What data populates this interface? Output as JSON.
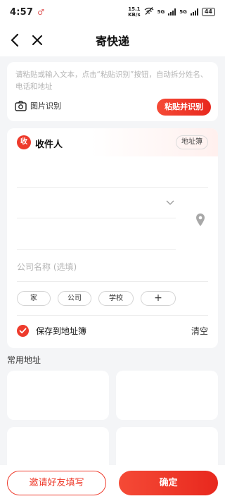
{
  "status_bar": {
    "time": "4:57",
    "speed_value": "15.1",
    "speed_unit": "KB/s",
    "net1": "5G",
    "net2": "5G",
    "battery": "44"
  },
  "header": {
    "title": "寄快递",
    "back_icon": "back-arrow-icon",
    "close_icon": "close-icon"
  },
  "paste": {
    "hint": "请粘贴或输入文本，点击“粘贴识别”按钮，自动拆分姓名、电话和地址",
    "photo_label": "图片识别",
    "paste_button": "粘贴并识别"
  },
  "recipient": {
    "badge": "收",
    "title": "收件人",
    "address_book": "地址簿",
    "company_placeholder": "公司名称 (选填)",
    "tags": [
      "家",
      "公司",
      "学校",
      "+"
    ],
    "save_label": "保存到地址簿",
    "clear_label": "清空"
  },
  "common": {
    "title": "常用地址"
  },
  "footer": {
    "invite": "邀请好友填写",
    "confirm": "确定"
  },
  "colors": {
    "accent": "#ee3b2c",
    "background": "#f4f5f7"
  }
}
